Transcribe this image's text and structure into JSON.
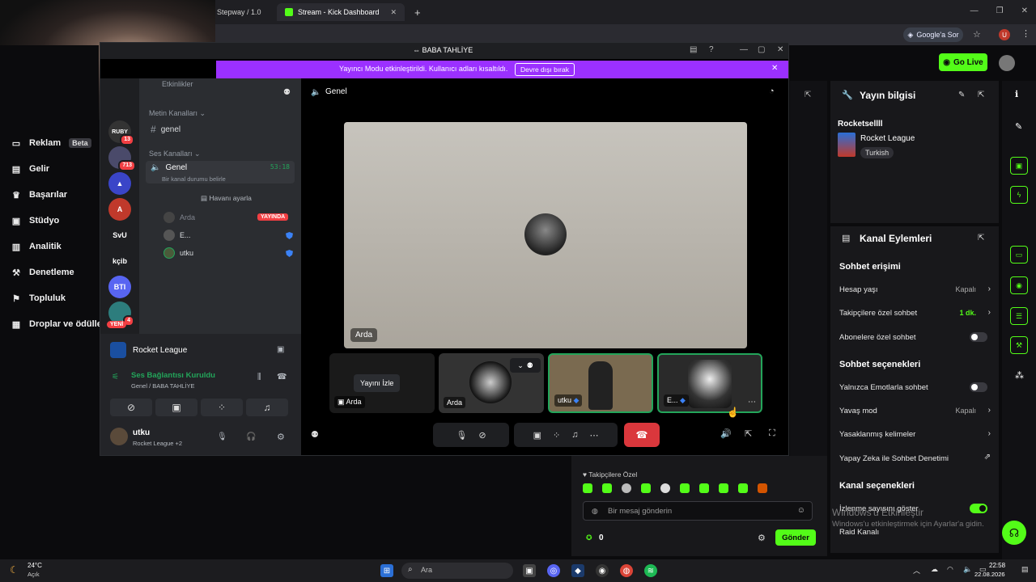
{
  "browser": {
    "tabs": [
      {
        "label": "Stepway / 1.0",
        "active": false
      },
      {
        "label": "Stream - Kick Dashboard",
        "active": true
      }
    ],
    "new_tab": "+",
    "google_btn": "Google'a Sor",
    "profile_initial": "U"
  },
  "kick": {
    "go_live": "Go Live",
    "sidebar": [
      {
        "label": "Reklam",
        "icon": "ad-icon",
        "badge": "Beta"
      },
      {
        "label": "Gelir",
        "icon": "revenue-icon"
      },
      {
        "label": "Başarılar",
        "icon": "trophy-icon"
      },
      {
        "label": "Stüdyo",
        "icon": "studio-icon"
      },
      {
        "label": "Analitik",
        "icon": "analytics-icon"
      },
      {
        "label": "Denetleme",
        "icon": "moderation-icon"
      },
      {
        "label": "Topluluk",
        "icon": "community-icon"
      },
      {
        "label": "Droplar ve ödülle",
        "icon": "drops-icon"
      }
    ],
    "stream_info": {
      "title": "Yayın bilgisi",
      "stream_title": "Rocketsellll",
      "category": "Rocket League",
      "tag": "Turkish"
    },
    "channel_actions": {
      "title": "Kanal Eylemleri",
      "chat_access_h": "Sohbet erişimi",
      "rows1": [
        {
          "label": "Hesap yaşı",
          "value": "Kapalı",
          "kind": "chevron"
        },
        {
          "label": "Takipçilere özel sohbet",
          "value": "1 dk.",
          "kind": "chevron",
          "value_color": "#53fc18"
        },
        {
          "label": "Abonelere özel sohbet",
          "value": "",
          "kind": "toggle-off"
        }
      ],
      "chat_options_h": "Sohbet seçenekleri",
      "rows2": [
        {
          "label": "Yalnızca Emotlarla sohbet",
          "value": "",
          "kind": "toggle-off"
        },
        {
          "label": "Yavaş mod",
          "value": "Kapalı",
          "kind": "chevron"
        },
        {
          "label": "Yasaklanmış kelimeler",
          "value": "",
          "kind": "chevron"
        },
        {
          "label": "Yapay Zeka ile Sohbet Denetimi",
          "value": "",
          "kind": "external"
        }
      ],
      "channel_options_h": "Kanal seçenekleri",
      "rows3": [
        {
          "label": "İzlenme sayısını göster",
          "kind": "toggle-on"
        },
        {
          "label": "Raid Kanalı",
          "kind": "none"
        }
      ]
    },
    "chat": {
      "followers_only": "Takipçilere Özel",
      "placeholder": "Bir mesaj gönderin",
      "points": "0",
      "send": "Gönder"
    },
    "watermark_line1": "Windows'u Etkinleştir",
    "watermark_line2": "Windows'u etkinleştirmek için Ayarlar'a gidin."
  },
  "discord": {
    "window_title": "BABA TAHLİYE",
    "streamer_msg": "Yayıncı Modu etkinleştirildi. Kullanıcı adları kısaltıldı.",
    "streamer_btn": "Devre dışı bırak",
    "servers": [
      {
        "label": "RUBY",
        "badge": "13",
        "color": "#333"
      },
      {
        "label": "",
        "badge": "713",
        "color": "#4a4a6a"
      },
      {
        "label": "",
        "badge": "",
        "color": "#3a45c8"
      },
      {
        "label": "A",
        "badge": "",
        "color": "#c0392b"
      },
      {
        "label": "SvU",
        "badge": "",
        "color": "#1e1f22"
      },
      {
        "label": "kçib",
        "badge": "",
        "color": "#1e1f22"
      },
      {
        "label": "BTI",
        "badge": "",
        "color": "#5865f2"
      },
      {
        "label": "",
        "badge": "4",
        "color": "#2d7d7d"
      }
    ],
    "new_badge": "YENİ",
    "events": "Etkinlikler",
    "text_category": "Metin Kanalları",
    "text_channel": "genel",
    "voice_category": "Ses Kanalları",
    "voice_channel": "Genel",
    "voice_timer": "53:18",
    "voice_status_hint": "Bir kanal durumu belirle",
    "set_atmosphere": "Havanı ayarla",
    "members": [
      {
        "name": "Arda",
        "live": "YAYINDA"
      },
      {
        "name": "E...",
        "live": ""
      },
      {
        "name": "utku",
        "live": ""
      }
    ],
    "activity": "Rocket League",
    "voice_connected": "Ses Bağlantısı Kuruldu",
    "voice_location": "Genel / BABA TAHLİYE",
    "user_name": "utku",
    "user_status": "Rocket League +2",
    "call_header": "Genel",
    "main_stage_label": "Arda",
    "tiles": [
      {
        "label": "Arda",
        "overlay": "Yayını İzle"
      },
      {
        "label": "Arda",
        "overlay": ""
      },
      {
        "label": "utku",
        "overlay": ""
      },
      {
        "label": "E...",
        "overlay": ""
      }
    ]
  },
  "taskbar": {
    "weather_temp": "24°C",
    "weather_desc": "Açık",
    "search": "Ara",
    "time": "22:58",
    "date": "22.08.2026"
  }
}
